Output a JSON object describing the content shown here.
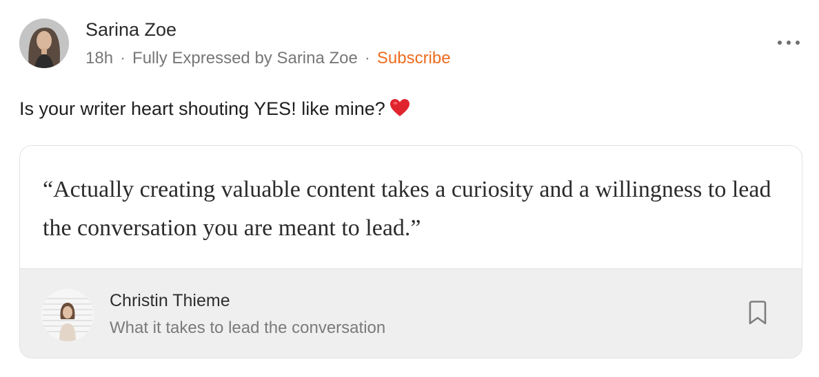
{
  "post": {
    "author": "Sarina Zoe",
    "time": "18h",
    "separator": "·",
    "publication": "Fully Expressed by Sarina Zoe",
    "subscribe_label": "Subscribe",
    "text": "Is your writer heart shouting YES! like mine?",
    "icons": {
      "more": "more-options-icon",
      "heart": "red-heart-emoji"
    }
  },
  "quote_card": {
    "quote": "“Actually creating valuable content takes a curiosity and a willingness to lead the conversation you are meant to lead.”",
    "source_author": "Christin Thieme",
    "source_title": "What it takes to lead the conversation",
    "icons": {
      "bookmark": "bookmark-icon"
    }
  },
  "colors": {
    "accent_subscribe": "#ee6b1d",
    "heart": "#e0242e",
    "footer_bg": "#efefef",
    "border": "#e2e2e2",
    "meta_text": "#777777"
  }
}
